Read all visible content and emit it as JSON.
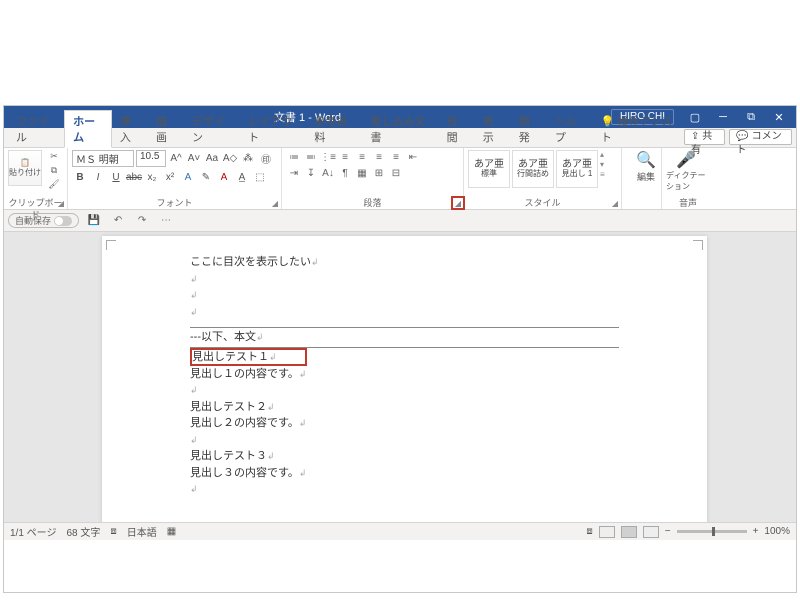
{
  "title": "文書 1 - Word",
  "user": "HIRO CHI",
  "win": {
    "min": "─",
    "max": "⧉",
    "close": "✕",
    "ribmin": "▢"
  },
  "tabs": [
    "ファイル",
    "ホーム",
    "挿入",
    "描画",
    "デザイン",
    "レイアウト",
    "参考資料",
    "差し込み文書",
    "校閲",
    "表示",
    "開発",
    "ヘルプ"
  ],
  "activeTab": 1,
  "tell": "操作アシスト",
  "share": "共有",
  "comment": "コメント",
  "clip": {
    "paste": "貼り付け",
    "label": "クリップボード"
  },
  "font": {
    "name": "ＭＳ 明朝",
    "size": "10.5",
    "label": "フォント",
    "btns": {
      "b": "B",
      "i": "I",
      "u": "U",
      "strike": "abc",
      "sub": "x₂",
      "sup": "x²",
      "a": "A",
      "aa": "Aa",
      "inc": "A^",
      "dec": "A˅",
      "clear": "A◇",
      "phon": "⁂",
      "enc": "㊞"
    }
  },
  "para": {
    "label": "段落",
    "icons": [
      "≔",
      "≕",
      "⋮≡",
      "≡",
      "≡",
      "≡",
      "≡",
      "⇤",
      "⇥",
      "↧",
      "A↓",
      "¶",
      "▦",
      "⊞",
      "⊟"
    ]
  },
  "styles": {
    "label": "スタイル",
    "items": [
      {
        "s": "あア亜",
        "n": "標準"
      },
      {
        "s": "あア亜",
        "n": "行間詰め"
      },
      {
        "s": "あア亜",
        "n": "見出し 1"
      }
    ]
  },
  "edit": {
    "label": "編集",
    "ic": "🔍"
  },
  "voice": {
    "label": "音声",
    "btn": "ディクテーション",
    "ic": "🎤"
  },
  "qat": {
    "autosave": "自動保存",
    "save": "💾",
    "undo": "↶",
    "redo": "↷",
    "cust": "⋯"
  },
  "doc": {
    "l1": "ここに目次を表示したい",
    "sep": "---以下、本文",
    "h1": "見出しテスト１",
    "b1": "見出し１の内容です。",
    "h2": "見出しテスト２",
    "b2": "見出し２の内容です。",
    "h3": "見出しテスト３",
    "b3": "見出し３の内容です。"
  },
  "status": {
    "page": "1/1 ページ",
    "words": "68 文字",
    "lang": "日本語",
    "zoom": "100%",
    "acc": "⧈"
  }
}
